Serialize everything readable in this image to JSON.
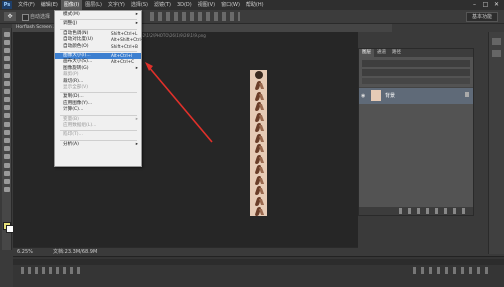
{
  "app": {
    "logo": "Ps"
  },
  "menubar": {
    "items": [
      "文件(F)",
      "编辑(E)",
      "图像(I)",
      "图层(L)",
      "文字(Y)",
      "选择(S)",
      "滤镜(T)",
      "3D(D)",
      "视图(V)",
      "窗口(W)",
      "帮助(H)"
    ],
    "active_index": 2
  },
  "window_controls": {
    "minimize": "–",
    "restore": "□",
    "close": "✕"
  },
  "options_bar": {
    "auto_select": "自动选择",
    "workspace": "基本功能"
  },
  "document_tab": {
    "title": "Horflash Screen ... .png @ 9.25%(RGB/8#) ×"
  },
  "canvas": {
    "hint_text": "...D:\\baidu.com\\...\\52\\1\\2\\PHOTO\\26\\1\\9\\26\\1\\9.png"
  },
  "image_menu": {
    "items": [
      {
        "label": "模式(M)",
        "shortcut": "",
        "submenu": true,
        "disabled": false
      },
      {
        "sep": true
      },
      {
        "label": "调整(J)",
        "shortcut": "",
        "submenu": true,
        "disabled": false
      },
      {
        "sep": true
      },
      {
        "label": "自动色调(N)",
        "shortcut": "Shift+Ctrl+L",
        "submenu": false,
        "disabled": false
      },
      {
        "label": "自动对比度(U)",
        "shortcut": "Alt+Shift+Ctrl+L",
        "submenu": false,
        "disabled": false
      },
      {
        "label": "自动颜色(O)",
        "shortcut": "Shift+Ctrl+B",
        "submenu": false,
        "disabled": false
      },
      {
        "sep": true
      },
      {
        "label": "图像大小(I)...",
        "shortcut": "Alt+Ctrl+I",
        "submenu": false,
        "disabled": false,
        "highlight": true
      },
      {
        "label": "画布大小(S)...",
        "shortcut": "Alt+Ctrl+C",
        "submenu": false,
        "disabled": false
      },
      {
        "label": "图像旋转(G)",
        "shortcut": "",
        "submenu": true,
        "disabled": false
      },
      {
        "label": "裁剪(P)",
        "shortcut": "",
        "submenu": false,
        "disabled": true
      },
      {
        "label": "裁切(R)...",
        "shortcut": "",
        "submenu": false,
        "disabled": false
      },
      {
        "label": "显示全部(V)",
        "shortcut": "",
        "submenu": false,
        "disabled": true
      },
      {
        "sep": true
      },
      {
        "label": "复制(D)...",
        "shortcut": "",
        "submenu": false,
        "disabled": false
      },
      {
        "label": "应用图像(Y)...",
        "shortcut": "",
        "submenu": false,
        "disabled": false
      },
      {
        "label": "计算(C)...",
        "shortcut": "",
        "submenu": false,
        "disabled": false
      },
      {
        "sep": true
      },
      {
        "label": "变量(B)",
        "shortcut": "",
        "submenu": true,
        "disabled": true
      },
      {
        "label": "应用数据组(L)...",
        "shortcut": "",
        "submenu": false,
        "disabled": true
      },
      {
        "sep": true
      },
      {
        "label": "陷印(T)...",
        "shortcut": "",
        "submenu": false,
        "disabled": true
      },
      {
        "sep": true
      },
      {
        "label": "分析(A)",
        "shortcut": "",
        "submenu": true,
        "disabled": false
      }
    ]
  },
  "layers_panel": {
    "tabs": [
      "图层",
      "通道",
      "路径"
    ],
    "layer_name": "背景"
  },
  "status_bar": {
    "zoom": "6.25%",
    "doc_info": "文档:23.3M/68.9M"
  },
  "colors": {
    "accent": "#3c7fd0",
    "arrow": "#e0302a",
    "image_bg": "#e6cbb6"
  }
}
